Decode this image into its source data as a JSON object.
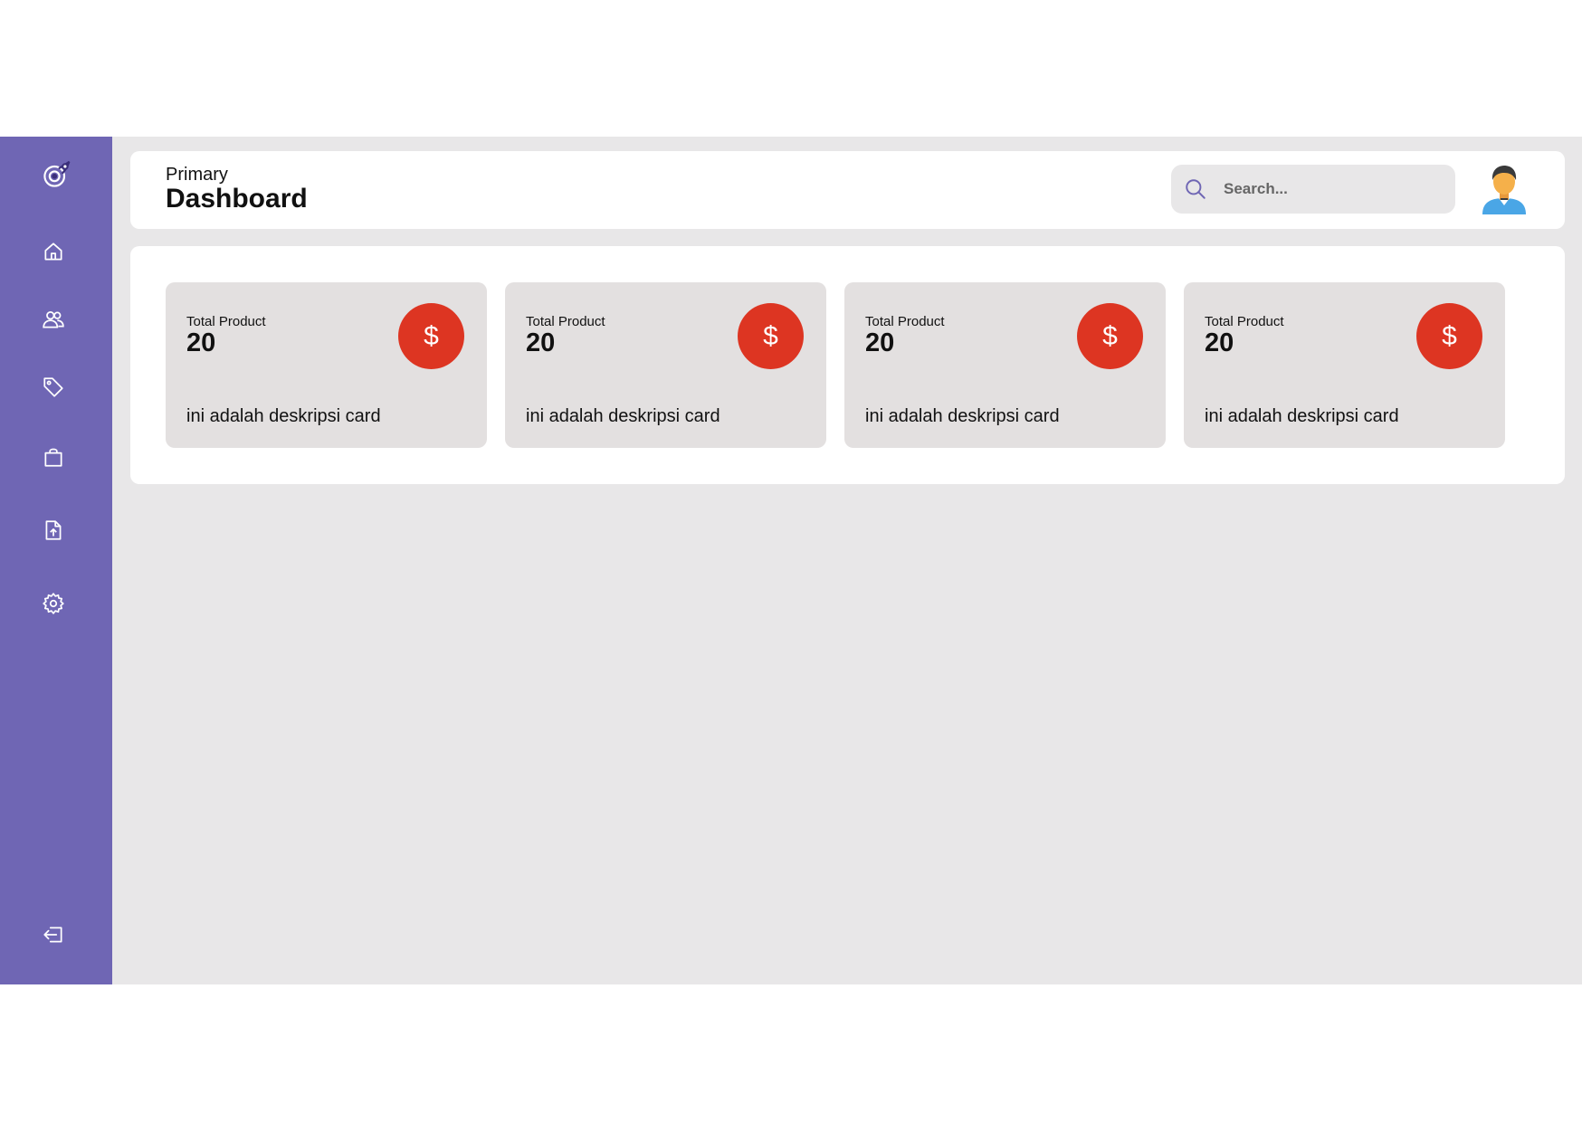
{
  "header": {
    "subtitle": "Primary",
    "title": "Dashboard"
  },
  "search": {
    "placeholder": "Search..."
  },
  "sidebar": {
    "icons": [
      "logo-icon",
      "home-icon",
      "users-icon",
      "tag-icon",
      "shopping-bag-icon",
      "file-upload-icon",
      "gear-icon",
      "logout-icon"
    ]
  },
  "cards": [
    {
      "label": "Total Product",
      "value": "20",
      "badge": "$",
      "description": "ini adalah deskripsi card"
    },
    {
      "label": "Total Product",
      "value": "20",
      "badge": "$",
      "description": "ini adalah deskripsi card"
    },
    {
      "label": "Total Product",
      "value": "20",
      "badge": "$",
      "description": "ini adalah deskripsi card"
    },
    {
      "label": "Total Product",
      "value": "20",
      "badge": "$",
      "description": "ini adalah deskripsi card"
    }
  ],
  "colors": {
    "sidebar": "#6f66b4",
    "background": "#e8e7e8",
    "card": "#e3e0e0",
    "badge": "#dd3522"
  }
}
